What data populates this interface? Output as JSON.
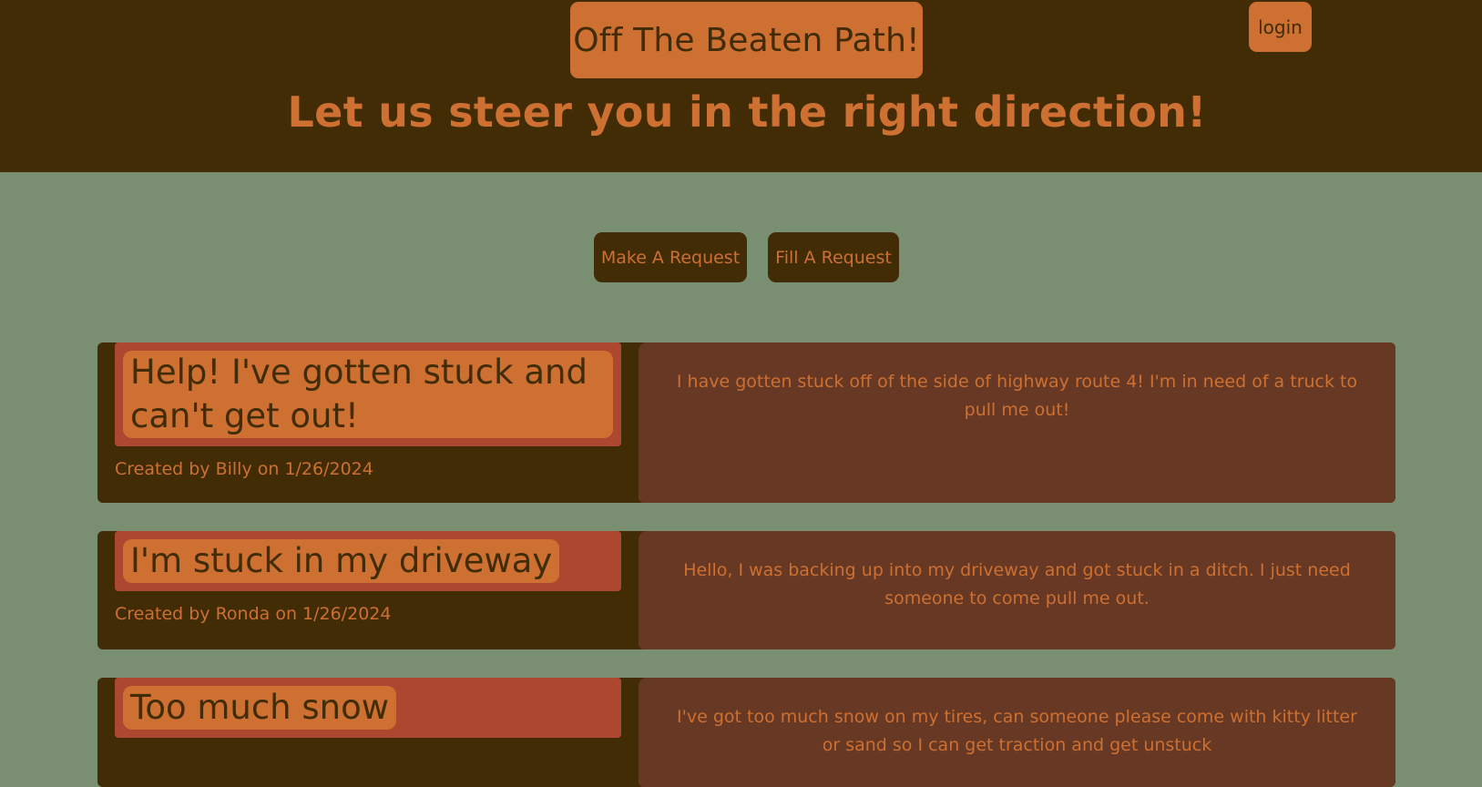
{
  "header": {
    "site_title": "Off The Beaten Path!",
    "login_label": "login",
    "tagline": "Let us steer you in the right direction!"
  },
  "actions": {
    "make_request": "Make A Request",
    "fill_request": "Fill A Request"
  },
  "requests": [
    {
      "title": "Help! I've gotten stuck and can't get out!",
      "created": "Created by Billy on 1/26/2024",
      "description": "I have gotten stuck off of the side of highway route 4! I'm in need of a truck to pull me out!"
    },
    {
      "title": "I'm stuck in my driveway",
      "created": "Created by Ronda on 1/26/2024",
      "description": "Hello, I was backing up into my driveway and got stuck in a ditch. I just need someone to come pull me out."
    },
    {
      "title": "Too much snow",
      "created": "",
      "description": "I've got too much snow on my tires, can someone please come with kitty litter or sand so I can get traction and get unstuck"
    }
  ]
}
